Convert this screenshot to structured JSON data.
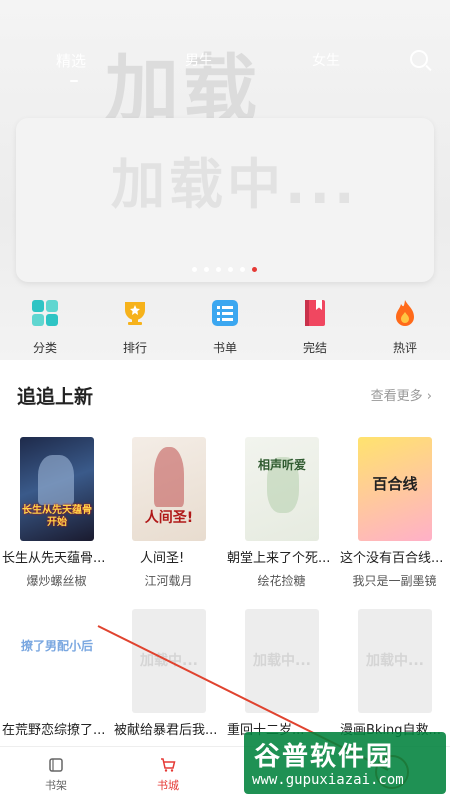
{
  "tabs": [
    "精选",
    "男生",
    "女生"
  ],
  "banner": {
    "placeholder": "加载中..."
  },
  "categories": [
    {
      "label": "分类",
      "icon": "grid-icon",
      "color": "#2ec4c4"
    },
    {
      "label": "排行",
      "icon": "trophy-icon",
      "color": "#f6b21b"
    },
    {
      "label": "书单",
      "icon": "list-icon",
      "color": "#3ba7f0"
    },
    {
      "label": "完结",
      "icon": "book-icon",
      "color": "#f04760"
    },
    {
      "label": "热评",
      "icon": "flame-icon",
      "color": "#ff6a1a"
    }
  ],
  "section": {
    "title": "追追上新",
    "more": "查看更多"
  },
  "books": [
    {
      "title": "长生从先天蕴骨...",
      "author": "爆炒螺丝椒",
      "cover_text": "长生从先天蕴骨开始"
    },
    {
      "title": "人间圣!",
      "author": "江河载月",
      "cover_text": "人间圣!"
    },
    {
      "title": "朝堂上来了个死...",
      "author": "绘花捡糖",
      "cover_text": "相声听爱"
    },
    {
      "title": "这个没有百合线...",
      "author": "我只是一副墨镜",
      "cover_text": "百合线"
    },
    {
      "title": "在荒野恋综撩了...",
      "author": "",
      "cover_text": "撩了男配小后"
    },
    {
      "title": "被献给暴君后我...",
      "author": "",
      "cover_text": "加载中..."
    },
    {
      "title": "重回十二岁...",
      "author": "",
      "cover_text": "加载中..."
    },
    {
      "title": "漫画Bking自救...",
      "author": "",
      "cover_text": "加载中..."
    }
  ],
  "nav": [
    {
      "label": "书架",
      "active": false
    },
    {
      "label": "书城",
      "active": true
    }
  ],
  "watermark": {
    "line1": "谷普软件园",
    "line2": "www.gupuxiazai.com"
  },
  "colors": {
    "accent": "#e53935",
    "watermark": "#00823c"
  }
}
